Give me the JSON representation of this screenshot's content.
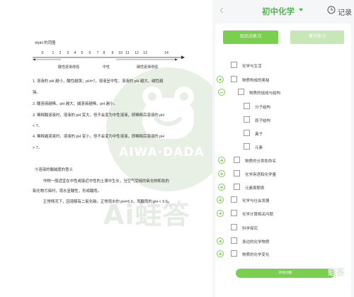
{
  "doc": {
    "scale_heading": "⑩pH 的范围",
    "scale_numbers": [
      "0",
      "1",
      "2",
      "3",
      "4",
      "5",
      "6",
      "7",
      "8",
      "9",
      "10",
      "11",
      "12",
      "13",
      "14"
    ],
    "scale_labels": [
      "酸性逐渐增强",
      "中性",
      "碱性逐渐增强"
    ],
    "p1": "1. 溶液的 pH 越小，酸性越强；pH=7，溶液呈中性；溶液的 pH 越大，碱性越",
    "p1b": "强。",
    "p2": "2. 酸溶液越稀，pH 越大；碱溶液越稀，pH 越小。",
    "p3": "3. 稀释酸溶液时，溶液的 pH 变大，但不会变为中性溶液，即稀释后溶液的 pH",
    "p3b": "< 7。",
    "p4": "4. 稀释碱溶液时，溶液的 pH 变小，但不会变为中性溶液，即稀释后溶液的 pH",
    "p4b": "> 7。",
    "section_heading": "⑪溶液的酸碱度的意义",
    "p5": "作物一般适宜在中性或接近中性的土壤中生长，当空气受硫的氧化物和氮的",
    "p5b": "氧化物污染时，雨水呈酸性，形成酸雨。",
    "p6": "正常情况下，因溶解有二氧化碳，正常雨水的 pH=5.6，而酸雨的 pH < 5.6。",
    "watermark_brand": "AIWA·DADA",
    "watermark_ai": "Ai蛙答"
  },
  "header": {
    "subject": "初中化学",
    "record": "记录"
  },
  "tabs": {
    "knowledge": "知识点练习",
    "chapter": "章节练习"
  },
  "tree": [
    {
      "label": "化学与生活"
    },
    {
      "label": "物质构成的奥秘"
    },
    {
      "label": "物质的组成与结构"
    },
    {
      "label": "分子结构"
    },
    {
      "label": "原子结构"
    },
    {
      "label": "离子"
    },
    {
      "label": "元素"
    },
    {
      "label": "物质的分类和命名"
    },
    {
      "label": "化学用语和化学量"
    },
    {
      "label": "元素周期表"
    },
    {
      "label": "化学与社会发展"
    },
    {
      "label": "化学计算相关问题"
    },
    {
      "label": "科学探究"
    },
    {
      "label": "身边的化学物质"
    },
    {
      "label": "物质的化学变化"
    }
  ],
  "start_button": "开始训练",
  "bottom_watermark": "蛙答",
  "colors": {
    "accent": "#7bcf4e",
    "accent_light": "#c7e8b6",
    "subject": "#4cb84c"
  },
  "icons": {
    "back": "chevron-left-icon",
    "dropdown": "caret-down-icon",
    "record": "clock-icon"
  }
}
